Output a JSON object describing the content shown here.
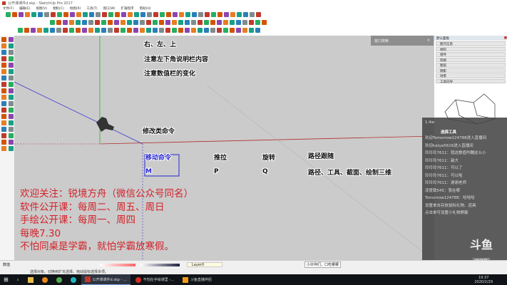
{
  "window": {
    "title": "公开课课件d.skp - SketchUp Pro 2017"
  },
  "menu": [
    "文件(F)",
    "编辑(E)",
    "视图(V)",
    "相机(C)",
    "绘图(R)",
    "工具(T)",
    "窗口(W)",
    "扩展程序",
    "帮助(H)"
  ],
  "viewport": {
    "top_labels": [
      "右、左、上",
      "注意左下角说明栏内容",
      "注意数值栏的变化"
    ],
    "modify_cmd": "修改类命令",
    "commands": [
      {
        "label": "移动命令",
        "key": "M"
      },
      {
        "label": "推拉",
        "key": "P"
      },
      {
        "label": "旋转",
        "key": "Q"
      },
      {
        "label": "路径跟随",
        "key": "路径、工具、截面、绘制三维"
      }
    ],
    "promo": [
      "欢迎关注：锐境方舟（微信公众号同名）",
      "软件公开课：每周二、周五、周日",
      "手绘公开课：每周一、周四",
      "每晚7.30",
      "不怕同桌是学霸，就怕学霸放寒假。"
    ],
    "search_popup": {
      "label": "窗口搜索",
      "close": "✕"
    }
  },
  "tray": {
    "title": "默认面板",
    "items": [
      "图元信息",
      "材料",
      "组件",
      "风格",
      "图层",
      "阴影",
      "场景",
      "工具向导"
    ]
  },
  "chat": {
    "header": "1.4w",
    "title": "选择工具",
    "messages": [
      "欢迎Tomorrow124788进入直播间",
      "欢迎katya5616进入直播间",
      "玲玲玲7611：我这数值咋蹦这么小",
      "玲玲玲7611：敲大",
      "玲玲玲7611：可以了",
      "玲玲玲7611：可以啦",
      "玲玲玲7611：谢谢老师",
      "凌度致545：我在哪",
      "Tomorrow124788：哈哈哈",
      "设置单击存放鼠标礼物、道具",
      "点击单可设置小礼物屏蔽"
    ]
  },
  "status": {
    "measure_label": "数值",
    "hint": "选择对象。切换到扩充选择。拖动鼠标选择多项。",
    "layer": "Layer0",
    "tooltip": "小伙伴们，口吃哪哪"
  },
  "douyu": {
    "logo": "斗鱼",
    "sub": "房间号",
    "room": "7704357"
  },
  "taskbar": {
    "tasks": [
      "公开课课件d.skp - ...",
      "不怕在手绘课里 -...",
      "斗鱼直播伴侣"
    ],
    "time": "19:37",
    "date": "2020/2/29"
  }
}
